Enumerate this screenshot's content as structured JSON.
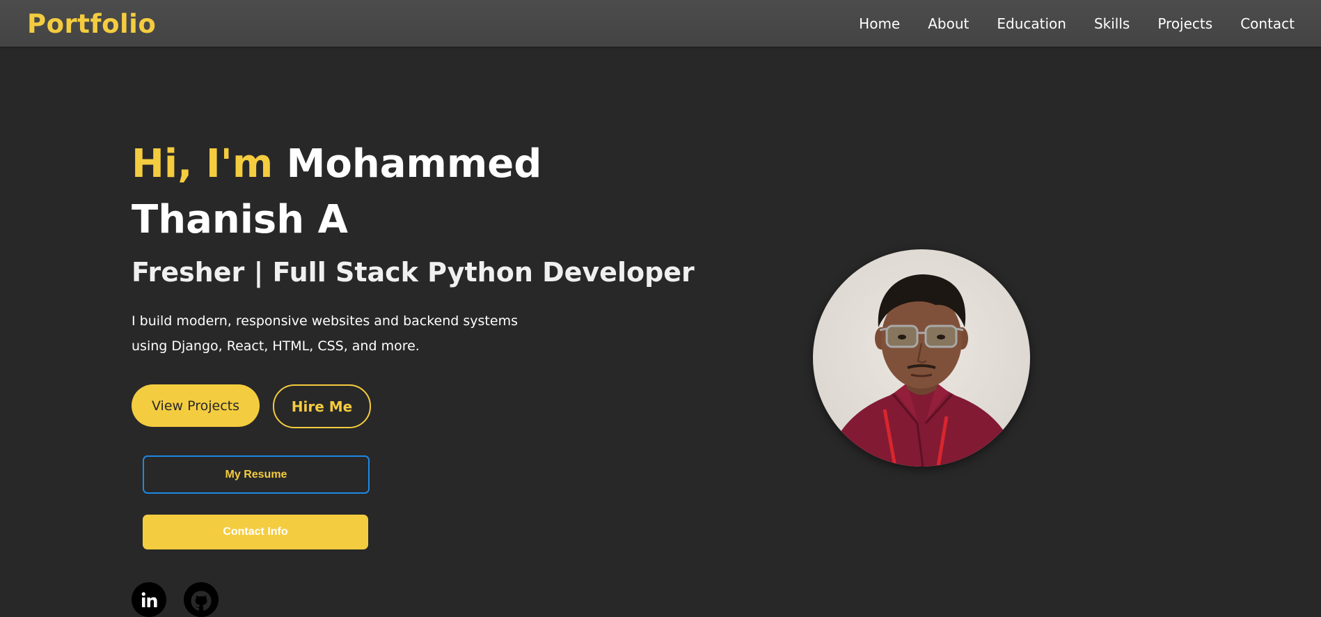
{
  "nav": {
    "brand": "Portfolio",
    "links": [
      "Home",
      "About",
      "Education",
      "Skills",
      "Projects",
      "Contact"
    ]
  },
  "hero": {
    "greeting": "Hi, I'm",
    "name": "Mohammed Thanish A",
    "role": "Fresher | Full Stack Python Developer",
    "description": "I build modern, responsive websites and backend systems using Django, React, HTML, CSS, and more.",
    "view_projects_label": "View Projects",
    "hire_me_label": "Hire Me",
    "resume_label": "My Resume",
    "contact_info_label": "Contact Info"
  },
  "social": {
    "icons": [
      "linkedin-icon",
      "github-icon"
    ]
  },
  "profile_photo": {
    "icon": "profile-photo"
  },
  "colors": {
    "accent": "#f4cc3f",
    "background": "#282828",
    "navbar": "#484848",
    "resume_border": "#1e88e5"
  }
}
